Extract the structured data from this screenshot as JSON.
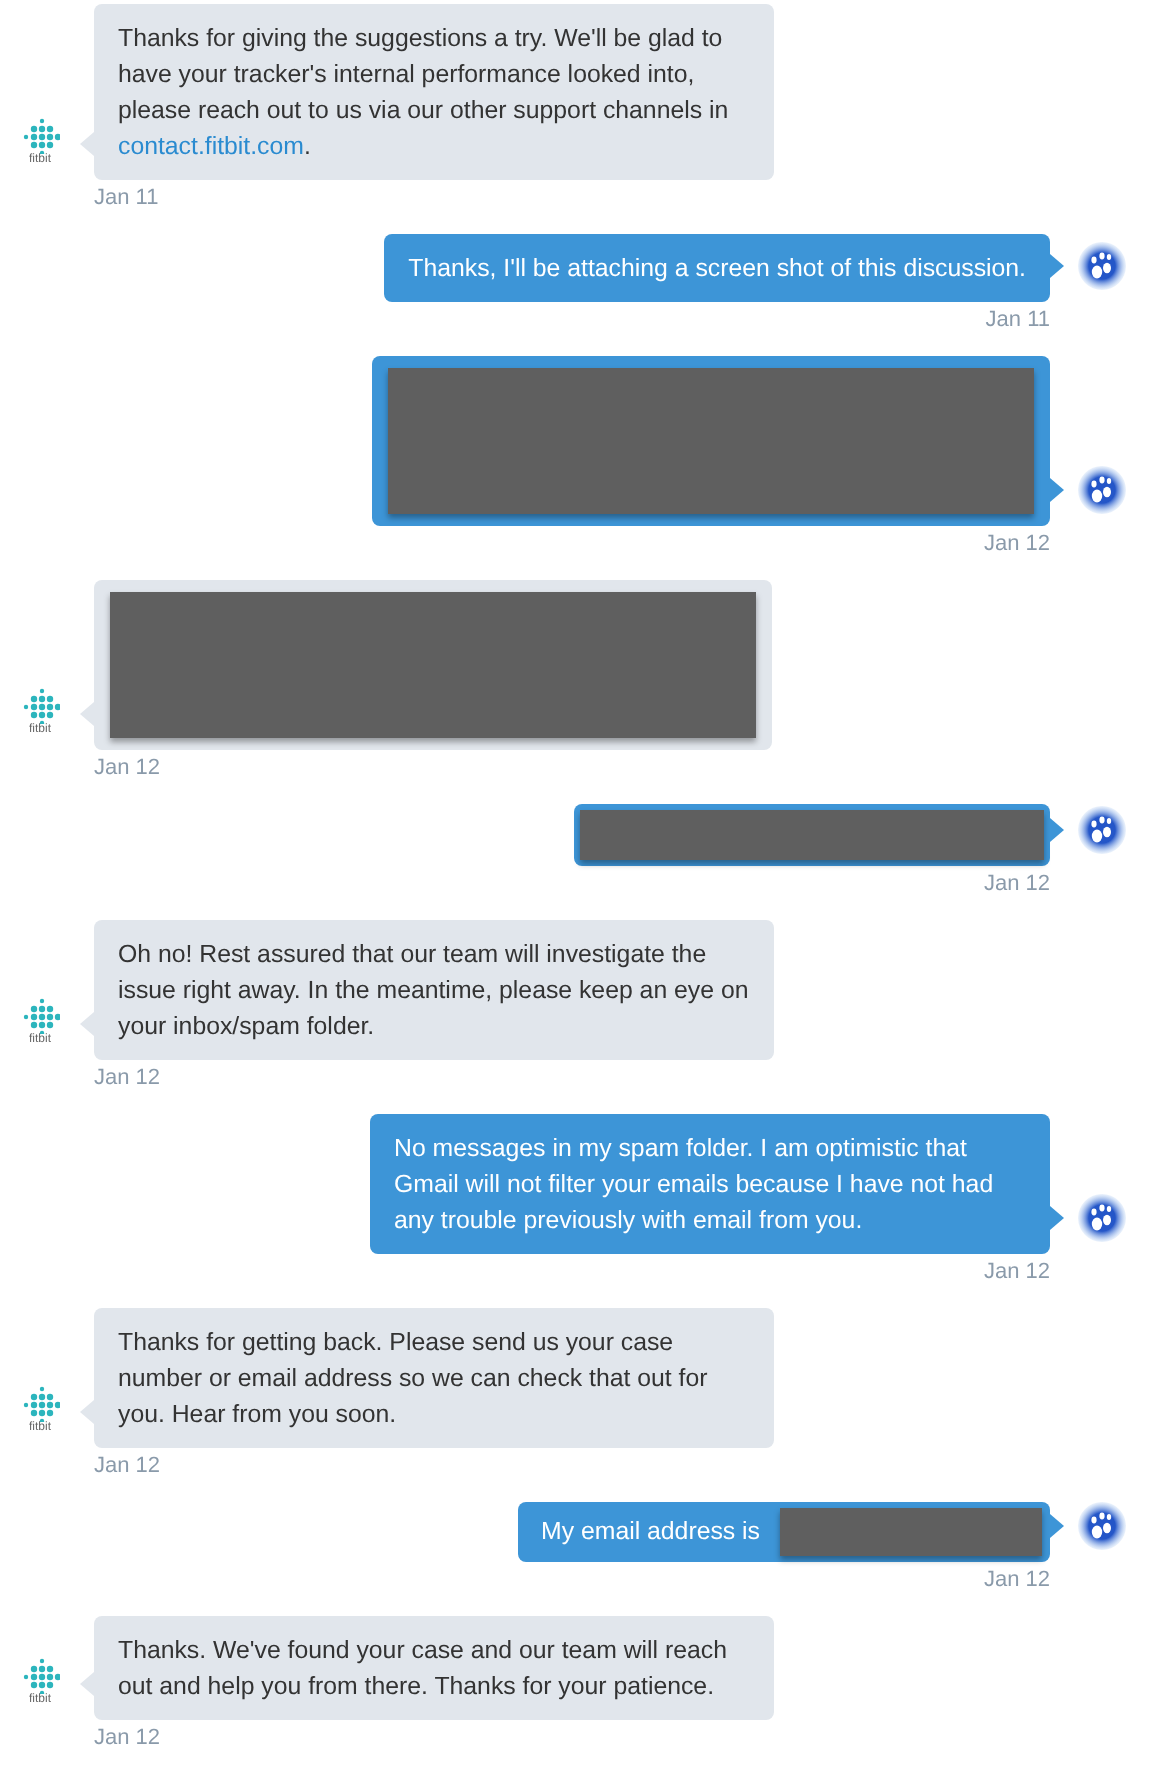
{
  "messages": [
    {
      "kind": "support",
      "logo_text": "fitbit",
      "parts": [
        {
          "kind": "text",
          "text": "Thanks for giving the suggestions a try. We'll be glad to have your tracker's internal performance looked into, please reach out to us via our other support channels in "
        },
        {
          "kind": "link",
          "text": "contact.fitbit.com"
        },
        {
          "kind": "text",
          "text": "."
        }
      ],
      "date": "Jan 11"
    },
    {
      "kind": "user",
      "parts": [
        {
          "kind": "text",
          "text": "Thanks, I'll be attaching a screen shot of this discussion."
        }
      ],
      "date": "Jan 11"
    },
    {
      "kind": "user",
      "parts": [
        {
          "kind": "redacted_block"
        }
      ],
      "date": "Jan 12"
    },
    {
      "kind": "support",
      "logo_text": "fitbit",
      "parts": [
        {
          "kind": "redacted_block"
        }
      ],
      "date": "Jan 12"
    },
    {
      "kind": "user",
      "parts": [
        {
          "kind": "redacted_line"
        }
      ],
      "date": "Jan 12"
    },
    {
      "kind": "support",
      "logo_text": "fitbit",
      "parts": [
        {
          "kind": "text",
          "text": "Oh no! Rest assured that our team will investigate the issue right away. In the meantime, please keep an eye on your inbox/spam folder."
        }
      ],
      "date": "Jan 12"
    },
    {
      "kind": "user",
      "parts": [
        {
          "kind": "text",
          "text": "No messages in my spam folder. I am optimistic that Gmail will not filter your emails because I have not had any trouble previously with email from you."
        }
      ],
      "date": "Jan 12"
    },
    {
      "kind": "support",
      "logo_text": "fitbit",
      "parts": [
        {
          "kind": "text",
          "text": "Thanks for getting back. Please send us your case number or email address so we can check that out for you. Hear from you soon."
        }
      ],
      "date": "Jan 12"
    },
    {
      "kind": "user",
      "parts": [
        {
          "kind": "text",
          "text": "My email address is"
        },
        {
          "kind": "redacted_inline"
        }
      ],
      "date": "Jan 12"
    },
    {
      "kind": "support",
      "logo_text": "fitbit",
      "parts": [
        {
          "kind": "text",
          "text": "Thanks. We've found your case and our team will reach out and help you from there. Thanks for your patience."
        }
      ],
      "date": "Jan 12"
    }
  ]
}
